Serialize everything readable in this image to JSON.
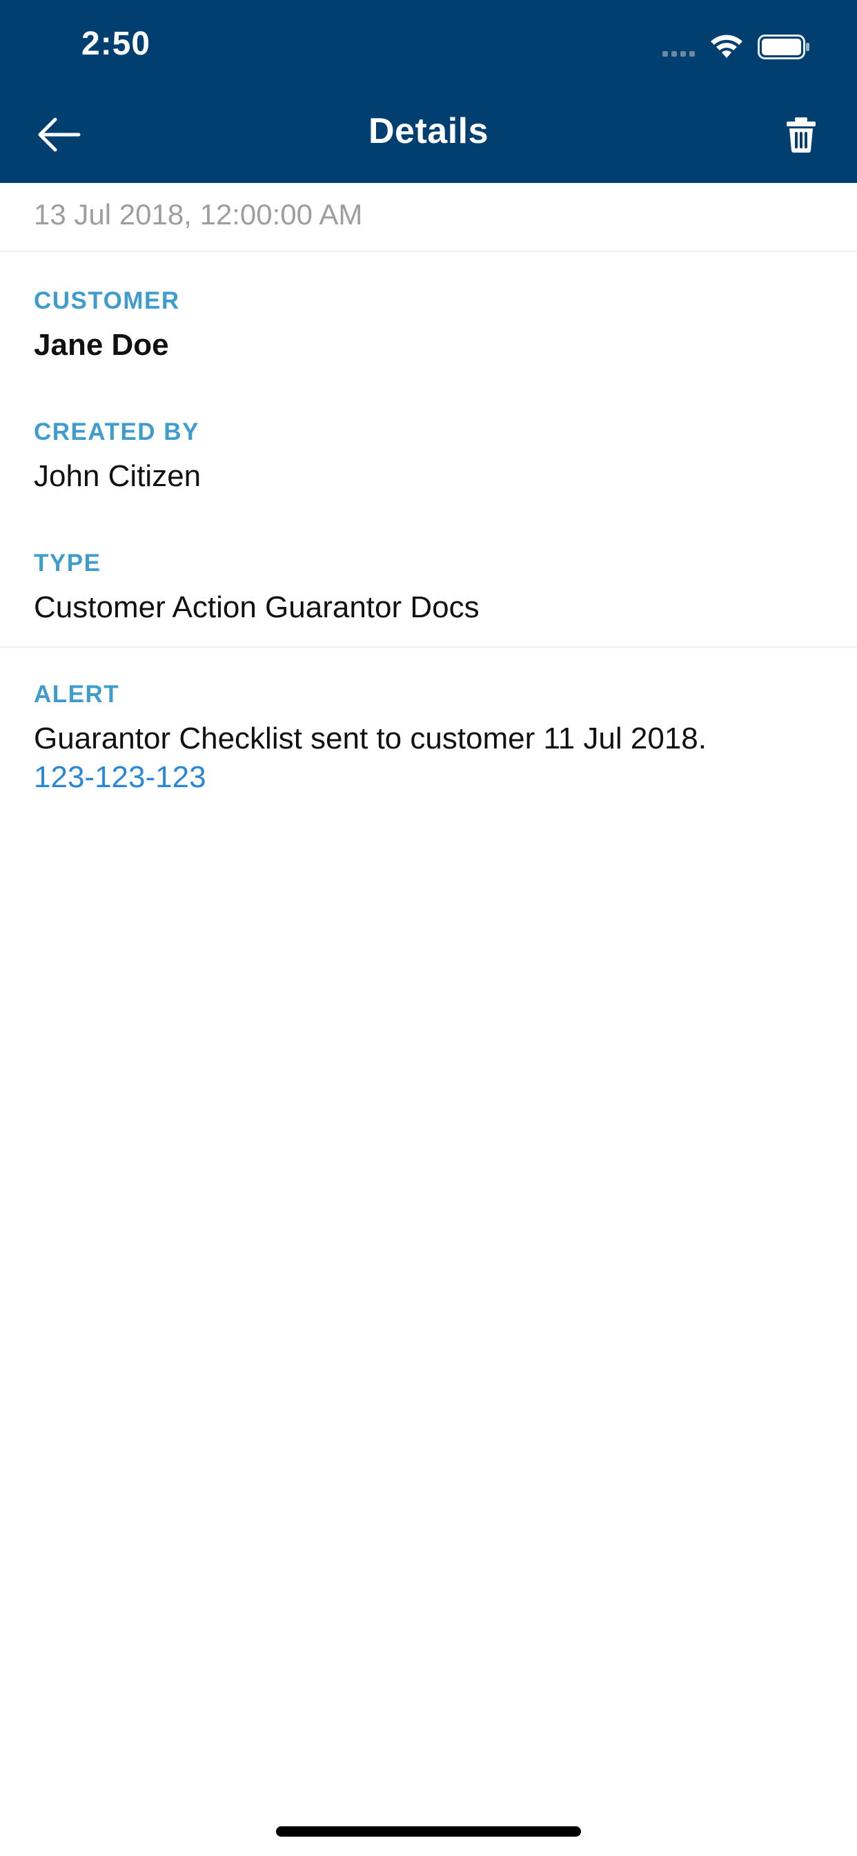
{
  "status_bar": {
    "time": "2:50"
  },
  "nav": {
    "title": "Details"
  },
  "date": "13 Jul 2018, 12:00:00 AM",
  "fields": {
    "customer": {
      "label": "CUSTOMER",
      "value": "Jane Doe"
    },
    "created_by": {
      "label": "CREATED BY",
      "value": "John Citizen"
    },
    "type": {
      "label": "TYPE",
      "value": "Customer Action Guarantor Docs"
    },
    "alert": {
      "label": "ALERT",
      "text": "Guarantor Checklist sent to customer 11 Jul 2018.",
      "link": "123-123-123"
    }
  },
  "colors": {
    "header_bg": "#003f70",
    "label": "#3e9dcc",
    "link": "#2a86d9",
    "muted": "#9e9e9e"
  }
}
